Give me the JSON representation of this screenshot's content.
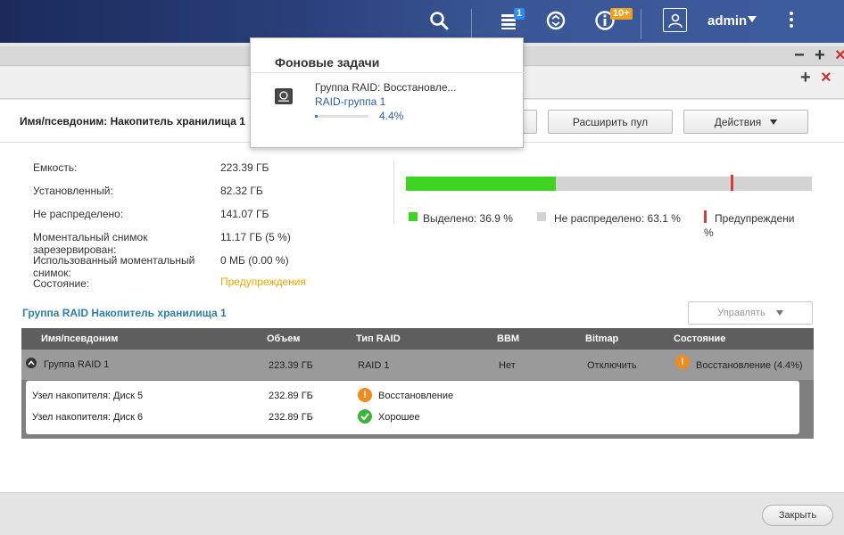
{
  "topbar": {
    "icons": [
      "search-icon",
      "tasks-icon",
      "sync-icon",
      "info-icon",
      "user-icon",
      "more-icon"
    ],
    "tasks_badge": "1",
    "info_badge": "10+",
    "user_name": "admin"
  },
  "alias": {
    "label": "Имя/псевдоним: Накопитель хранилища 1",
    "buttons": {
      "expand_pool": "Расширить пул",
      "actions": "Действия"
    }
  },
  "info": {
    "capacity_label": "Емкость:",
    "capacity_value": "223.39 ГБ",
    "installed_label": "Установленный:",
    "installed_value": "82.32 ГБ",
    "unallocated_label": "Не распределено:",
    "unallocated_value": "141.07 ГБ",
    "snapshot_reserved_label": "Моментальный снимок зарезервирован:",
    "snapshot_reserved_value": "11.17 ГБ (5 %)",
    "snapshot_used_label": "Использованный моментальный снимок:",
    "snapshot_used_value": "0 МБ (0.00 %)",
    "status_label": "Состояние:",
    "status_value": "Предупреждения"
  },
  "usage": {
    "allocated_fraction": 0.369,
    "warning_threshold_fraction": 0.8,
    "legend": {
      "allocated": "Выделено: 36.9 %",
      "unallocated": "Не распределено: 63.1 %",
      "warning": "Предупреждени",
      "warning_suffix": "%"
    },
    "colors": {
      "allocated": "#3ed422",
      "unallocated": "#d3d3d3",
      "warning": "#d63b3b"
    }
  },
  "raid": {
    "title": "Группа RAID Накопитель хранилища 1",
    "manage_label": "Управлять",
    "columns": [
      "Имя/псевдоним",
      "Объем",
      "Тип RAID",
      "BBM",
      "Bitmap",
      "Состояние"
    ],
    "group": {
      "name": "Группа RAID 1",
      "size": "223.39 ГБ",
      "type": "RAID 1",
      "bbm": "Нет",
      "bitmap": "Отключить",
      "status": "Восстановление (4.4%)"
    },
    "disks": [
      {
        "name": "Узел накопителя: Диск 5",
        "size": "232.89 ГБ",
        "status": "Восстановление",
        "status_icon": "warning-icon"
      },
      {
        "name": "Узел накопителя: Диск 6",
        "size": "232.89 ГБ",
        "status": "Хорошее",
        "status_icon": "check-icon"
      }
    ]
  },
  "footer": {
    "close_label": "Закрыть"
  },
  "popup": {
    "title": "Фоновые задачи",
    "task_title": "Группа RAID: Восстановле...",
    "task_subtitle": "RAID-группа 1",
    "progress_fraction": 0.044,
    "progress_text": "4.4%"
  }
}
